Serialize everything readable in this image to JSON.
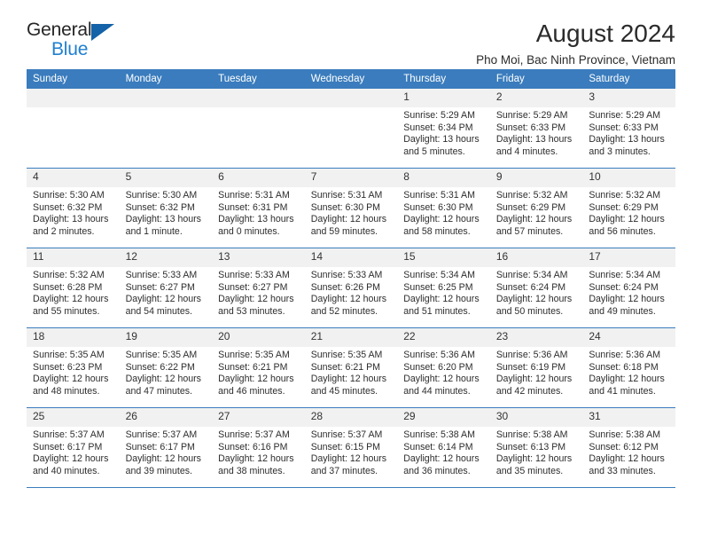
{
  "brand": {
    "name_top": "General",
    "name_bottom": "Blue",
    "triangle_color": "#1462a8",
    "blue_color": "#1f7fd0"
  },
  "header": {
    "title": "August 2024",
    "subtitle": "Pho Moi, Bac Ninh Province, Vietnam",
    "accent_color": "#3a7cbd"
  },
  "weekdays": [
    "Sunday",
    "Monday",
    "Tuesday",
    "Wednesday",
    "Thursday",
    "Friday",
    "Saturday"
  ],
  "labels": {
    "sunrise_prefix": "Sunrise:",
    "sunset_prefix": "Sunset:",
    "daylight_prefix": "Daylight:"
  },
  "weeks": [
    [
      {
        "day": "",
        "empty": true
      },
      {
        "day": "",
        "empty": true
      },
      {
        "day": "",
        "empty": true
      },
      {
        "day": "",
        "empty": true
      },
      {
        "day": "1",
        "sunrise": "Sunrise: 5:29 AM",
        "sunset": "Sunset: 6:34 PM",
        "daylight1": "Daylight: 13 hours",
        "daylight2": "and 5 minutes."
      },
      {
        "day": "2",
        "sunrise": "Sunrise: 5:29 AM",
        "sunset": "Sunset: 6:33 PM",
        "daylight1": "Daylight: 13 hours",
        "daylight2": "and 4 minutes."
      },
      {
        "day": "3",
        "sunrise": "Sunrise: 5:29 AM",
        "sunset": "Sunset: 6:33 PM",
        "daylight1": "Daylight: 13 hours",
        "daylight2": "and 3 minutes."
      }
    ],
    [
      {
        "day": "4",
        "sunrise": "Sunrise: 5:30 AM",
        "sunset": "Sunset: 6:32 PM",
        "daylight1": "Daylight: 13 hours",
        "daylight2": "and 2 minutes."
      },
      {
        "day": "5",
        "sunrise": "Sunrise: 5:30 AM",
        "sunset": "Sunset: 6:32 PM",
        "daylight1": "Daylight: 13 hours",
        "daylight2": "and 1 minute."
      },
      {
        "day": "6",
        "sunrise": "Sunrise: 5:31 AM",
        "sunset": "Sunset: 6:31 PM",
        "daylight1": "Daylight: 13 hours",
        "daylight2": "and 0 minutes."
      },
      {
        "day": "7",
        "sunrise": "Sunrise: 5:31 AM",
        "sunset": "Sunset: 6:30 PM",
        "daylight1": "Daylight: 12 hours",
        "daylight2": "and 59 minutes."
      },
      {
        "day": "8",
        "sunrise": "Sunrise: 5:31 AM",
        "sunset": "Sunset: 6:30 PM",
        "daylight1": "Daylight: 12 hours",
        "daylight2": "and 58 minutes."
      },
      {
        "day": "9",
        "sunrise": "Sunrise: 5:32 AM",
        "sunset": "Sunset: 6:29 PM",
        "daylight1": "Daylight: 12 hours",
        "daylight2": "and 57 minutes."
      },
      {
        "day": "10",
        "sunrise": "Sunrise: 5:32 AM",
        "sunset": "Sunset: 6:29 PM",
        "daylight1": "Daylight: 12 hours",
        "daylight2": "and 56 minutes."
      }
    ],
    [
      {
        "day": "11",
        "sunrise": "Sunrise: 5:32 AM",
        "sunset": "Sunset: 6:28 PM",
        "daylight1": "Daylight: 12 hours",
        "daylight2": "and 55 minutes."
      },
      {
        "day": "12",
        "sunrise": "Sunrise: 5:33 AM",
        "sunset": "Sunset: 6:27 PM",
        "daylight1": "Daylight: 12 hours",
        "daylight2": "and 54 minutes."
      },
      {
        "day": "13",
        "sunrise": "Sunrise: 5:33 AM",
        "sunset": "Sunset: 6:27 PM",
        "daylight1": "Daylight: 12 hours",
        "daylight2": "and 53 minutes."
      },
      {
        "day": "14",
        "sunrise": "Sunrise: 5:33 AM",
        "sunset": "Sunset: 6:26 PM",
        "daylight1": "Daylight: 12 hours",
        "daylight2": "and 52 minutes."
      },
      {
        "day": "15",
        "sunrise": "Sunrise: 5:34 AM",
        "sunset": "Sunset: 6:25 PM",
        "daylight1": "Daylight: 12 hours",
        "daylight2": "and 51 minutes."
      },
      {
        "day": "16",
        "sunrise": "Sunrise: 5:34 AM",
        "sunset": "Sunset: 6:24 PM",
        "daylight1": "Daylight: 12 hours",
        "daylight2": "and 50 minutes."
      },
      {
        "day": "17",
        "sunrise": "Sunrise: 5:34 AM",
        "sunset": "Sunset: 6:24 PM",
        "daylight1": "Daylight: 12 hours",
        "daylight2": "and 49 minutes."
      }
    ],
    [
      {
        "day": "18",
        "sunrise": "Sunrise: 5:35 AM",
        "sunset": "Sunset: 6:23 PM",
        "daylight1": "Daylight: 12 hours",
        "daylight2": "and 48 minutes."
      },
      {
        "day": "19",
        "sunrise": "Sunrise: 5:35 AM",
        "sunset": "Sunset: 6:22 PM",
        "daylight1": "Daylight: 12 hours",
        "daylight2": "and 47 minutes."
      },
      {
        "day": "20",
        "sunrise": "Sunrise: 5:35 AM",
        "sunset": "Sunset: 6:21 PM",
        "daylight1": "Daylight: 12 hours",
        "daylight2": "and 46 minutes."
      },
      {
        "day": "21",
        "sunrise": "Sunrise: 5:35 AM",
        "sunset": "Sunset: 6:21 PM",
        "daylight1": "Daylight: 12 hours",
        "daylight2": "and 45 minutes."
      },
      {
        "day": "22",
        "sunrise": "Sunrise: 5:36 AM",
        "sunset": "Sunset: 6:20 PM",
        "daylight1": "Daylight: 12 hours",
        "daylight2": "and 44 minutes."
      },
      {
        "day": "23",
        "sunrise": "Sunrise: 5:36 AM",
        "sunset": "Sunset: 6:19 PM",
        "daylight1": "Daylight: 12 hours",
        "daylight2": "and 42 minutes."
      },
      {
        "day": "24",
        "sunrise": "Sunrise: 5:36 AM",
        "sunset": "Sunset: 6:18 PM",
        "daylight1": "Daylight: 12 hours",
        "daylight2": "and 41 minutes."
      }
    ],
    [
      {
        "day": "25",
        "sunrise": "Sunrise: 5:37 AM",
        "sunset": "Sunset: 6:17 PM",
        "daylight1": "Daylight: 12 hours",
        "daylight2": "and 40 minutes."
      },
      {
        "day": "26",
        "sunrise": "Sunrise: 5:37 AM",
        "sunset": "Sunset: 6:17 PM",
        "daylight1": "Daylight: 12 hours",
        "daylight2": "and 39 minutes."
      },
      {
        "day": "27",
        "sunrise": "Sunrise: 5:37 AM",
        "sunset": "Sunset: 6:16 PM",
        "daylight1": "Daylight: 12 hours",
        "daylight2": "and 38 minutes."
      },
      {
        "day": "28",
        "sunrise": "Sunrise: 5:37 AM",
        "sunset": "Sunset: 6:15 PM",
        "daylight1": "Daylight: 12 hours",
        "daylight2": "and 37 minutes."
      },
      {
        "day": "29",
        "sunrise": "Sunrise: 5:38 AM",
        "sunset": "Sunset: 6:14 PM",
        "daylight1": "Daylight: 12 hours",
        "daylight2": "and 36 minutes."
      },
      {
        "day": "30",
        "sunrise": "Sunrise: 5:38 AM",
        "sunset": "Sunset: 6:13 PM",
        "daylight1": "Daylight: 12 hours",
        "daylight2": "and 35 minutes."
      },
      {
        "day": "31",
        "sunrise": "Sunrise: 5:38 AM",
        "sunset": "Sunset: 6:12 PM",
        "daylight1": "Daylight: 12 hours",
        "daylight2": "and 33 minutes."
      }
    ]
  ]
}
